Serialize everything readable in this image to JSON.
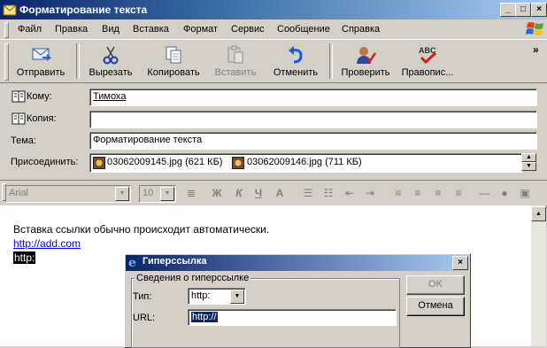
{
  "window": {
    "title": "Форматирование текста",
    "minimize": "_",
    "maximize": "□",
    "close": "×"
  },
  "menu": [
    "Файл",
    "Правка",
    "Вид",
    "Вставка",
    "Формат",
    "Сервис",
    "Сообщение",
    "Справка"
  ],
  "toolbar": {
    "send": "Отправить",
    "cut": "Вырезать",
    "copy": "Копировать",
    "paste": "Вставить",
    "undo": "Отменить",
    "check": "Проверить",
    "spelling": "Правопис...",
    "more": "»"
  },
  "header": {
    "to_label": "Кому:",
    "to_value": "Тимоха",
    "cc_label": "Копия:",
    "cc_value": "",
    "subject_label": "Тема:",
    "subject_value": "Форматирование текста",
    "attach_label": "Присоединить:",
    "attachments": [
      "03062009145.jpg (621 КБ)",
      "03062009146.jpg (711 КБ)"
    ]
  },
  "format": {
    "font": "Arial",
    "size": "10"
  },
  "body": {
    "line1": "Вставка ссылки обычно происходит автоматически.",
    "link": "http://add.com",
    "selected": "http:"
  },
  "dialog": {
    "title": "Гиперссылка",
    "close": "×",
    "group": "Сведения о гиперссылке",
    "type_label": "Тип:",
    "type_value": "http:",
    "url_label": "URL:",
    "url_value": "http://",
    "ok": "OK",
    "cancel": "Отмена"
  },
  "colors": {
    "title_start": "#0a246a",
    "title_end": "#a6caf0",
    "link": "#0000ff",
    "face": "#d4d0c8"
  }
}
